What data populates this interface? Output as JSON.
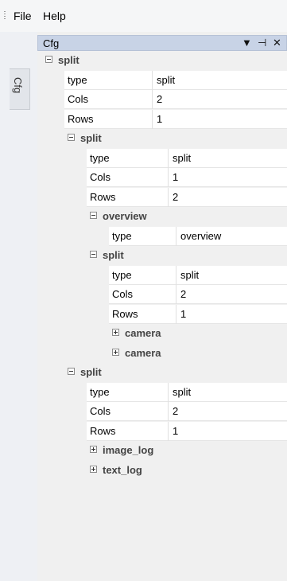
{
  "menubar": {
    "items": [
      "File",
      "Help"
    ]
  },
  "dock": {
    "side_tab_label": "Cfg"
  },
  "panel": {
    "title": "Cfg",
    "dropdown_icon": "▼",
    "pin_icon": "⊣",
    "close_icon": "✕"
  },
  "tree": {
    "rows": [
      {
        "kind": "section",
        "depth": 0,
        "label": "split",
        "state": "expanded"
      },
      {
        "kind": "prop",
        "depth": 1,
        "name": "type",
        "value": "split"
      },
      {
        "kind": "prop",
        "depth": 1,
        "name": "Cols",
        "value": "2"
      },
      {
        "kind": "prop",
        "depth": 1,
        "name": "Rows",
        "value": "1"
      },
      {
        "kind": "section",
        "depth": 1,
        "label": "split",
        "state": "expanded"
      },
      {
        "kind": "prop",
        "depth": 2,
        "name": "type",
        "value": "split"
      },
      {
        "kind": "prop",
        "depth": 2,
        "name": "Cols",
        "value": "1"
      },
      {
        "kind": "prop",
        "depth": 2,
        "name": "Rows",
        "value": "2"
      },
      {
        "kind": "section",
        "depth": 2,
        "label": "overview",
        "state": "expanded"
      },
      {
        "kind": "prop",
        "depth": 3,
        "name": "type",
        "value": "overview"
      },
      {
        "kind": "section",
        "depth": 2,
        "label": "split",
        "state": "expanded"
      },
      {
        "kind": "prop",
        "depth": 3,
        "name": "type",
        "value": "split"
      },
      {
        "kind": "prop",
        "depth": 3,
        "name": "Cols",
        "value": "2"
      },
      {
        "kind": "prop",
        "depth": 3,
        "name": "Rows",
        "value": "1"
      },
      {
        "kind": "section",
        "depth": 3,
        "label": "camera",
        "state": "collapsed"
      },
      {
        "kind": "section",
        "depth": 3,
        "label": "camera",
        "state": "collapsed"
      },
      {
        "kind": "section",
        "depth": 1,
        "label": "split",
        "state": "expanded"
      },
      {
        "kind": "prop",
        "depth": 2,
        "name": "type",
        "value": "split"
      },
      {
        "kind": "prop",
        "depth": 2,
        "name": "Cols",
        "value": "2"
      },
      {
        "kind": "prop",
        "depth": 2,
        "name": "Rows",
        "value": "1"
      },
      {
        "kind": "section",
        "depth": 2,
        "label": "image_log",
        "state": "collapsed"
      },
      {
        "kind": "section",
        "depth": 2,
        "label": "text_log",
        "state": "collapsed"
      }
    ]
  },
  "colors": {
    "header_bg": "#c8d3e6",
    "section_bg": "#f0f0f0",
    "prop_bg": "#ffffff"
  }
}
